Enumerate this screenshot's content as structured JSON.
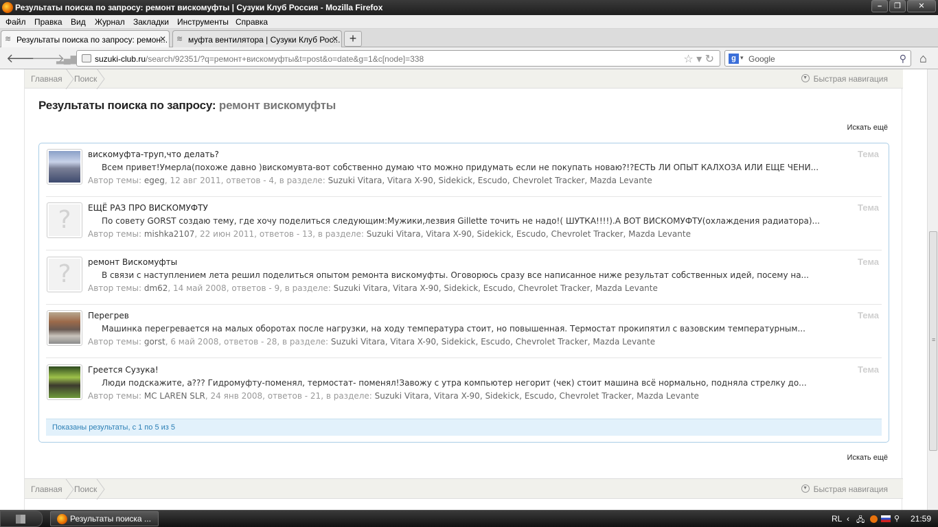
{
  "window": {
    "title": "Результаты поиска по запросу: ремонт вискомуфты | Сузуки Клуб Россия - Mozilla Firefox"
  },
  "menu": [
    "Файл",
    "Правка",
    "Вид",
    "Журнал",
    "Закладки",
    "Инструменты",
    "Справка"
  ],
  "tabs": [
    {
      "label": "Результаты поиска по запросу: ремон..."
    },
    {
      "label": "муфта вентилятора | Сузуки Клуб Рос..."
    }
  ],
  "address": {
    "domain": "suzuki-club.ru",
    "path": "/search/92351/?q=ремонт+вискомуфты&t=post&o=date&g=1&c[node]=338"
  },
  "search_box": {
    "placeholder": "Google"
  },
  "breadcrumb": {
    "home": "Главная",
    "search": "Поиск",
    "quick_nav": "Быстрая навигация"
  },
  "page": {
    "title_prefix": "Результаты поиска по запросу:",
    "query": "ремонт вискомуфты",
    "search_more": "Искать ещё",
    "shown": "Показаны результаты, с 1 по 5 из 5"
  },
  "results": [
    {
      "title": "вискомуфта-труп,что делать?",
      "snippet": "Всем привет!Умерла(похоже давно )вискомувта-вот собственно думаю что можно придумать если не покупать новаю?!?ЕСТЬ ЛИ ОПЫТ КАЛХОЗА ИЛИ ЕЩЕ ЧЕНИ...",
      "meta_prefix": "Автор темы:",
      "author": "egeg",
      "date": "12 авг 2011",
      "replies": "ответов - 4",
      "section_prefix": "в разделе:",
      "section": "Suzuki Vitara, Vitara X-90, Sidekick, Escudo, Chevrolet Tracker, Mazda Levante",
      "type": "Тема",
      "avatar": "photo"
    },
    {
      "title": "ЕЩЁ РАЗ ПРО ВИСКОМУФТУ",
      "snippet": "По совету GORST создаю тему, где хочу поделиться следующим:Мужики,лезвия Gillette точить не надо!( ШУТКА!!!!).А ВОТ ВИСКОМУФТУ(охлаждения радиатора)...",
      "meta_prefix": "Автор темы:",
      "author": "mishka2107",
      "date": "22 июн 2011",
      "replies": "ответов - 13",
      "section_prefix": "в разделе:",
      "section": "Suzuki Vitara, Vitara X-90, Sidekick, Escudo, Chevrolet Tracker, Mazda Levante",
      "type": "Тема",
      "avatar": "placeholder"
    },
    {
      "title": "ремонт Вискомуфты",
      "snippet": "В связи с наступлением лета решил поделиться опытом ремонта вискомуфты. Оговорюсь сразу все написанное ниже результат собственных идей, посему на...",
      "meta_prefix": "Автор темы:",
      "author": "dm62",
      "date": "14 май 2008",
      "replies": "ответов - 9",
      "section_prefix": "в разделе:",
      "section": "Suzuki Vitara, Vitara X-90, Sidekick, Escudo, Chevrolet Tracker, Mazda Levante",
      "type": "Тема",
      "avatar": "placeholder"
    },
    {
      "title": "Перегрев",
      "snippet": "Машинка перегревается на малых оборотах после нагрузки, на ходу температура стоит, но повышенная. Термостат прокипятил с вазовским температурным...",
      "meta_prefix": "Автор темы:",
      "author": "gorst",
      "date": "6 май 2008",
      "replies": "ответов - 28",
      "section_prefix": "в разделе:",
      "section": "Suzuki Vitara, Vitara X-90, Sidekick, Escudo, Chevrolet Tracker, Mazda Levante",
      "type": "Тема",
      "avatar": "photo"
    },
    {
      "title": "Греется Сузука!",
      "snippet": "Люди подскажите, а??? Гидромуфту-поменял, термостат- поменял!Завожу с утра компьютер негорит (чек) стоит машина всё нормально, подняла стрелку до...",
      "meta_prefix": "Автор темы:",
      "author": "MC LAREN SLR",
      "date": "24 янв 2008",
      "replies": "ответов - 21",
      "section_prefix": "в разделе:",
      "section": "Suzuki Vitara, Vitara X-90, Sidekick, Escudo, Chevrolet Tracker, Mazda Levante",
      "type": "Тема",
      "avatar": "photo"
    }
  ],
  "taskbar": {
    "window_button": "Результаты поиска ...",
    "lang": "RL",
    "clock": "21:59"
  }
}
